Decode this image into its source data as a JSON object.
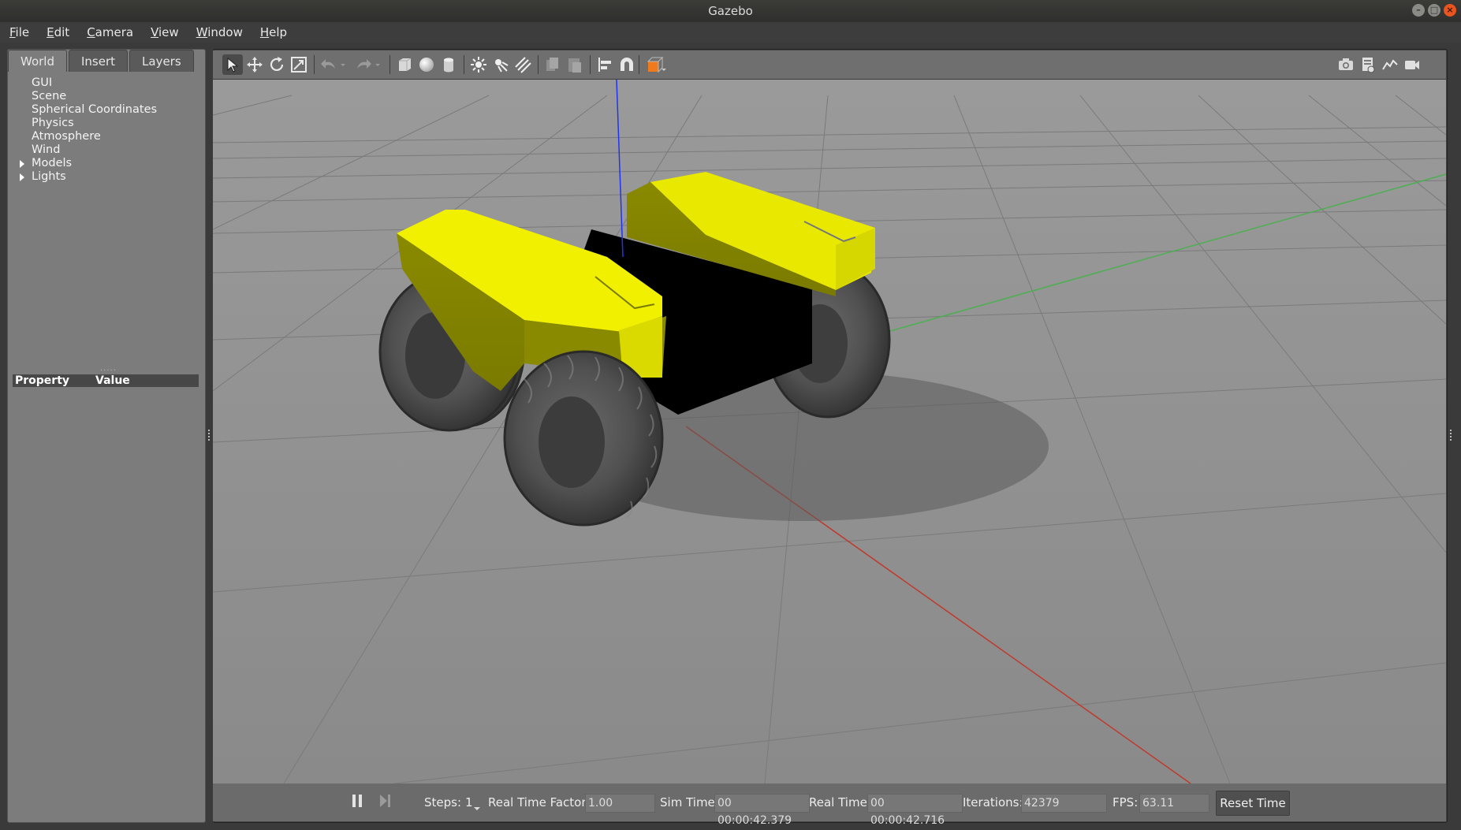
{
  "window": {
    "title": "Gazebo"
  },
  "menu": [
    "File",
    "Edit",
    "Camera",
    "View",
    "Window",
    "Help"
  ],
  "left_panel": {
    "tabs": [
      "World",
      "Insert",
      "Layers"
    ],
    "tree": [
      {
        "label": "GUI",
        "expandable": false
      },
      {
        "label": "Scene",
        "expandable": false
      },
      {
        "label": "Spherical Coordinates",
        "expandable": false
      },
      {
        "label": "Physics",
        "expandable": false
      },
      {
        "label": "Atmosphere",
        "expandable": false
      },
      {
        "label": "Wind",
        "expandable": false
      },
      {
        "label": "Models",
        "expandable": true
      },
      {
        "label": "Lights",
        "expandable": true
      }
    ],
    "property_header": {
      "property": "Property",
      "value": "Value"
    }
  },
  "toolbar": {
    "icons": [
      "select-arrow-icon",
      "translate-icon",
      "rotate-icon",
      "scale-icon",
      "undo-icon",
      "undo-dropdown-icon",
      "redo-icon",
      "redo-dropdown-icon",
      "box-icon",
      "sphere-icon",
      "cylinder-icon",
      "point-light-icon",
      "spot-light-icon",
      "directional-light-icon",
      "copy-icon",
      "paste-icon",
      "align-icon",
      "snap-magnet-icon",
      "view-angle-icon",
      "screenshot-icon",
      "log-icon",
      "plot-icon",
      "record-video-icon"
    ]
  },
  "bottom_bar": {
    "steps_label": "Steps:",
    "steps_value": "1",
    "rtf_label": "Real Time Factor:",
    "rtf_value": "1.00",
    "sim_time_label": "Sim Time:",
    "sim_time_value": "00 00:00:42.379",
    "real_time_label": "Real Time:",
    "real_time_value": "00 00:00:42.716",
    "iterations_label": "Iterations:",
    "iterations_value": "42379",
    "fps_label": "FPS:",
    "fps_value": "63.11",
    "reset_label": "Reset Time"
  },
  "colors": {
    "robot_body": "#f0f000",
    "robot_chassis": "#000000",
    "ground": "#8e8e8e",
    "x_axis": "#c0392b",
    "y_axis": "#4caf50",
    "z_axis": "#2233ee"
  }
}
